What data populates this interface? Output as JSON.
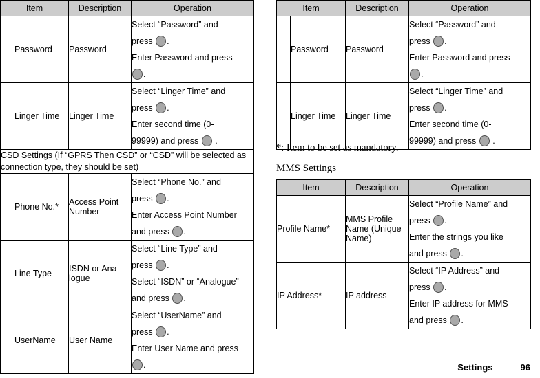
{
  "document": {
    "footer": {
      "section": "Settings",
      "page_number": "96"
    }
  },
  "left_table": {
    "headers": {
      "item": "Item",
      "description": "Description",
      "operation": "Operation"
    },
    "rows": [
      {
        "item": "Password",
        "description": "Password",
        "operation_lines": [
          "Select “Password” and",
          "press  .",
          "Enter Password and press",
          " ."
        ]
      },
      {
        "item": "Linger Time",
        "description": "Linger Time",
        "operation_lines": [
          "Select “Linger Time” and",
          "press  .",
          "Enter second time (0-",
          "99999) and press  ."
        ]
      }
    ],
    "merged_row": "CSD Settings (If “GPRS Then CSD” or “CSD” will be selected as connection type, they should be set)",
    "rows2": [
      {
        "item": "Phone No.*",
        "description": "Access Point Number",
        "operation_lines": [
          "Select “Phone No.” and",
          "press  .",
          "Enter Access Point Number",
          "and press  ."
        ]
      },
      {
        "item": "Line Type",
        "description": "ISDN or Ana-logue",
        "operation_lines": [
          "Select “Line Type” and",
          "press  .",
          "Select “ISDN” or “Analogue”",
          "and press  ."
        ]
      },
      {
        "item": "UserName",
        "description": "User Name",
        "operation_lines": [
          "Select “UserName” and",
          "press  .",
          "Enter User Name and press",
          " ."
        ]
      }
    ]
  },
  "right_table": {
    "headers": {
      "item": "Item",
      "description": "Description",
      "operation": "Operation"
    },
    "rows": [
      {
        "item": "Password",
        "description": "Password",
        "operation_lines": [
          "Select “Password” and",
          "press  .",
          "Enter Password and press",
          " ."
        ]
      },
      {
        "item": "Linger Time",
        "description": "Linger Time",
        "operation_lines": [
          "Select “Linger Time” and",
          "press  .",
          "Enter second time (0-",
          "99999) and press  ."
        ]
      }
    ]
  },
  "notes": {
    "mandatory": "*: Item to be set as mandatory."
  },
  "mms_section": {
    "title": "MMS Settings",
    "headers": {
      "item": "Item",
      "description": "Description",
      "operation": "Operation"
    },
    "rows": [
      {
        "item": "Profile Name*",
        "description": "MMS Profile Name (Unique Name)",
        "operation_lines": [
          "Select “Profile Name” and",
          "press  .",
          "Enter the strings you like",
          "and press  ."
        ]
      },
      {
        "item": "IP Address*",
        "description": "IP address",
        "operation_lines": [
          "Select “IP Address” and",
          "press  .",
          "Enter IP address for MMS",
          "and press  ."
        ]
      }
    ]
  },
  "colors": {
    "header_bg": "#cccccc",
    "key_fill": "#a9a9a9",
    "key_border": "#4d4d4d",
    "border": "#000000"
  },
  "text_fragments": {
    "press": "press",
    "and_press": "and press",
    "period": "."
  }
}
